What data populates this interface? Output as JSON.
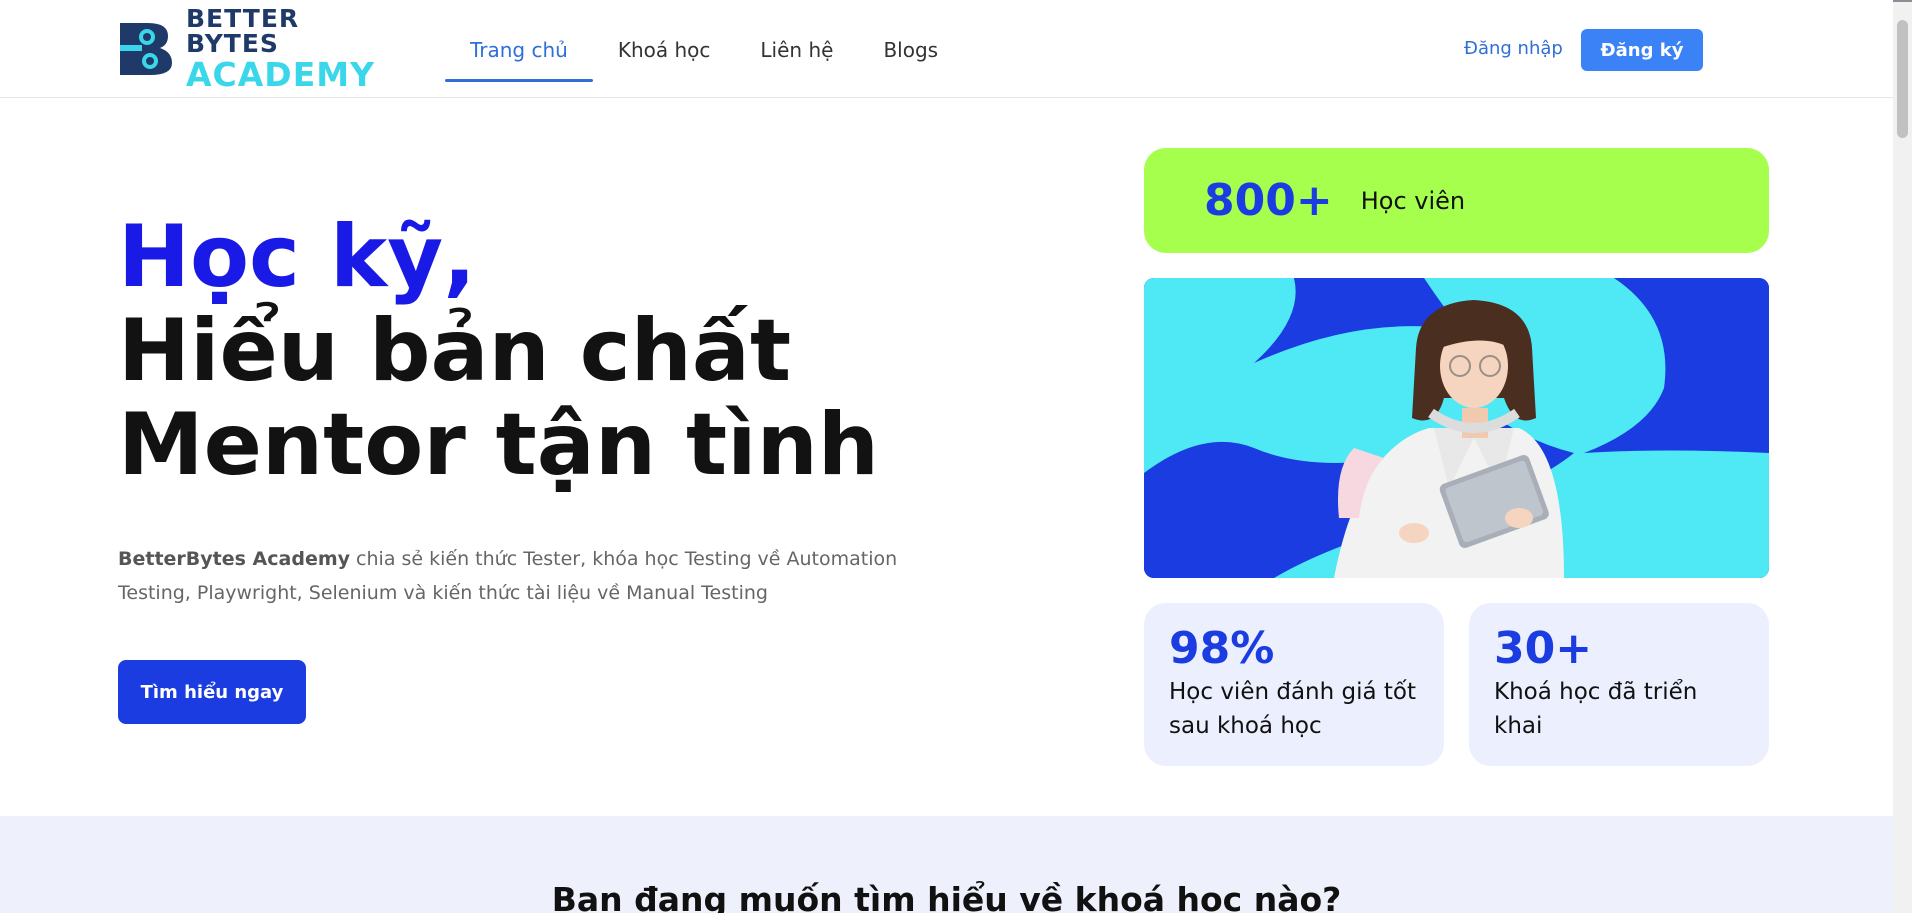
{
  "brand": {
    "line1": "BETTER BYTES",
    "line2": "ACADEMY"
  },
  "nav": {
    "items": [
      {
        "label": "Trang chủ",
        "active": true
      },
      {
        "label": "Khoá học",
        "active": false
      },
      {
        "label": "Liên hệ",
        "active": false
      },
      {
        "label": "Blogs",
        "active": false
      }
    ],
    "login_label": "Đăng nhập",
    "signup_label": "Đăng ký"
  },
  "hero": {
    "title_line1": "Học kỹ,",
    "title_line2": "Hiểu bản chất",
    "title_line3": "Mentor tận tình",
    "desc_brand": "BetterBytes Academy",
    "desc_rest": " chia sẻ kiến thức Tester, khóa học Testing về Automation Testing, Playwright, Selenium và kiến thức tài liệu về Manual Testing",
    "cta_label": "Tìm hiểu ngay"
  },
  "stats": {
    "students": {
      "value": "800+",
      "label": "Học viên"
    },
    "rating": {
      "value": "98%",
      "label": "Học viên đánh giá tốt sau khoá học"
    },
    "courses": {
      "value": "30+",
      "label": "Khoá học đã triển khai"
    }
  },
  "section2": {
    "title": "Bạn đang muốn tìm hiểu về khoá học nào?"
  },
  "colors": {
    "primary": "#1a3ce0",
    "nav_active": "#2f6fd8",
    "stat_green": "#a6ff4d",
    "card_bg": "#eceffd",
    "accent_cyan": "#4fe8f5"
  }
}
